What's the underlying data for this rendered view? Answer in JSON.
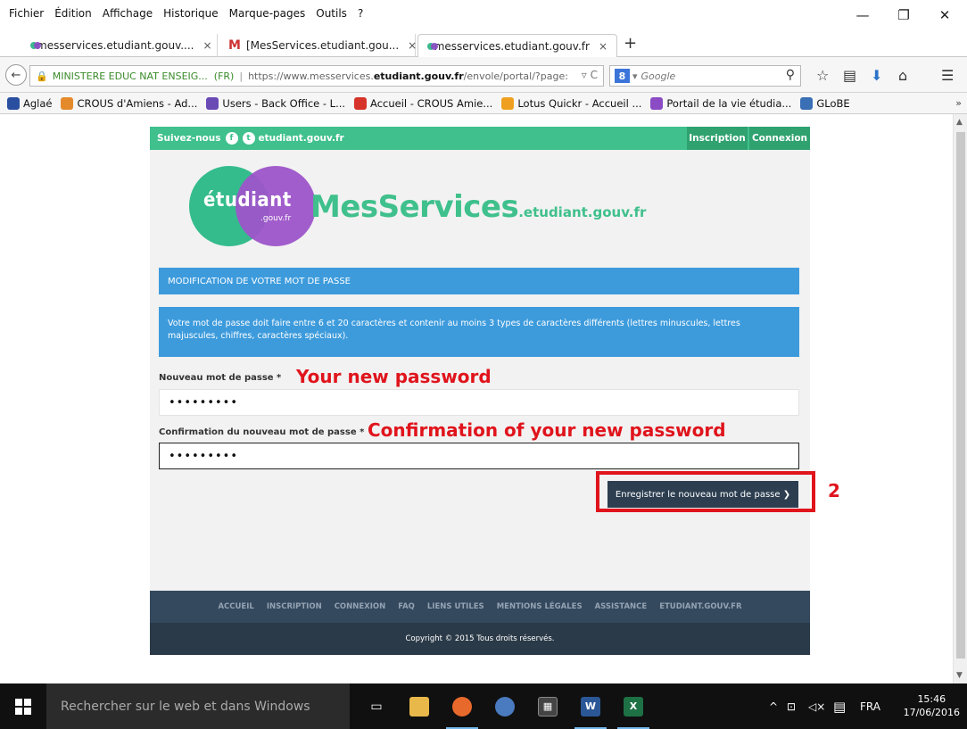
{
  "menu": [
    "Fichier",
    "Édition",
    "Affichage",
    "Historique",
    "Marque-pages",
    "Outils",
    "?"
  ],
  "window_controls": {
    "minimize": "—",
    "restore": "❐",
    "close": "✕"
  },
  "tabs": [
    {
      "title": "messervices.etudiant.gouv....",
      "icon": "etudiant-favicon",
      "active": false
    },
    {
      "title": "[MesServices.etudiant.gou...",
      "icon": "gmail-icon",
      "active": false
    },
    {
      "title": "messervices.etudiant.gouv.fr",
      "icon": "etudiant-favicon",
      "active": true
    }
  ],
  "tab_close": "×",
  "new_tab": "+",
  "navbar": {
    "identity": "MINISTERE EDUC NAT ENSEIG...",
    "identity_country": "(FR)",
    "url_prefix": "https://www.messervices.",
    "url_domain": "etudiant.gouv.fr",
    "url_suffix": "/envole/portal/?page:",
    "url_controls": "▿ C",
    "search_engine": "8",
    "search_placeholder": "Google",
    "search_dropdown": "▾"
  },
  "bookmarks": [
    {
      "label": "Aglaé",
      "color": "#2a4fa0"
    },
    {
      "label": "CROUS d'Amiens - Ad...",
      "color": "#e58a2a"
    },
    {
      "label": "Users - Back Office - L...",
      "color": "#6a4bb5"
    },
    {
      "label": "Accueil - CROUS Amie...",
      "color": "#d6332a"
    },
    {
      "label": "Lotus Quickr - Accueil ...",
      "color": "#f0a020"
    },
    {
      "label": "Portail de la vie étudia...",
      "color": "#8b4bc4"
    },
    {
      "label": "GLoBE",
      "color": "#3a6fb5"
    }
  ],
  "bookmarks_more": "»",
  "site": {
    "follow": "Suivez-nous",
    "follow_domain": "etudiant.gouv.fr",
    "inscription": "Inscription",
    "connexion": "Connexion",
    "logo_circle": "étudiant",
    "logo_circle_sub": ".gouv.fr",
    "logo_main": "MesServices",
    "logo_domain": ".etudiant.gouv.fr",
    "section_title": "MODIFICATION DE VOTRE MOT DE PASSE",
    "info": "Votre mot de passe doit faire entre 6 et 20 caractères et contenir au moins 3 types de caractères différents (lettres minuscules, lettres majuscules, chiffres, caractères spéciaux).",
    "new_pw_label": "Nouveau mot de passe *",
    "new_pw_value": "•••••••••",
    "confirm_pw_label": "Confirmation du nouveau mot de passe *",
    "confirm_pw_value": "•••••••••",
    "save_button": "Enregistrer le nouveau mot de passe ❯",
    "footer_links": [
      "ACCUEIL",
      "INSCRIPTION",
      "CONNEXION",
      "FAQ",
      "LIENS UTILES",
      "MENTIONS LÉGALES",
      "ASSISTANCE",
      "ETUDIANT.GOUV.FR"
    ],
    "copyright": "Copyright © 2015 Tous droits réservés."
  },
  "annotations": {
    "new_pw": "Your new password",
    "confirm_pw": "Confirmation of your new password",
    "step": "2",
    "color": "#e0141c"
  },
  "taskbar": {
    "search": "Rechercher sur le web et dans Windows",
    "lang": "FRA",
    "time": "15:46",
    "date": "17/06/2016"
  }
}
